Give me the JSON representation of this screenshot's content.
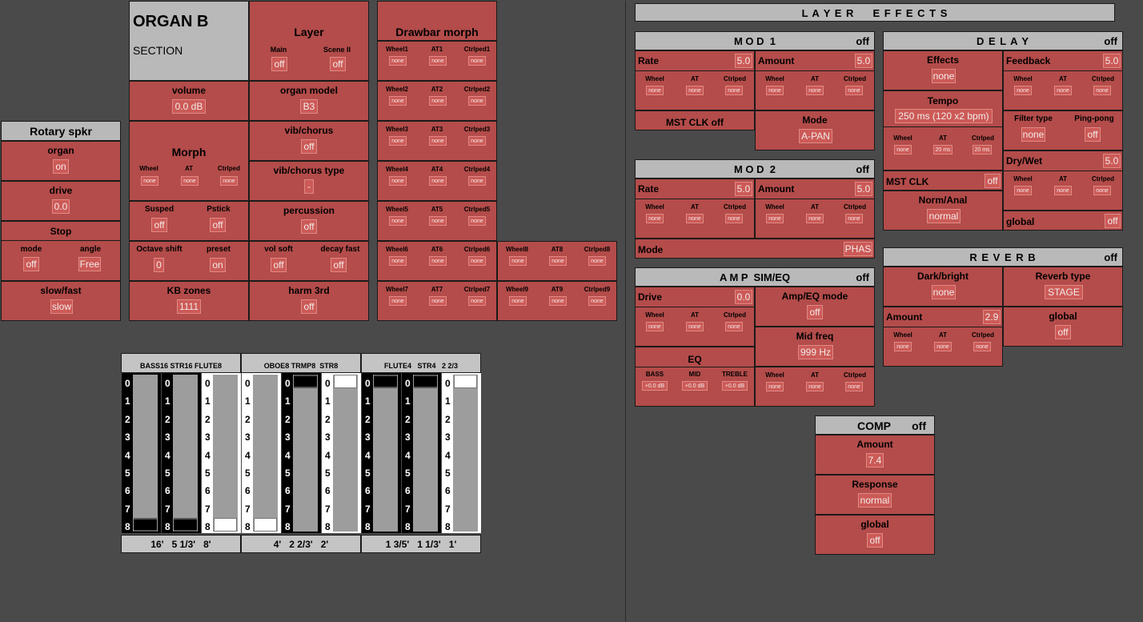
{
  "title": {
    "name": "ORGAN B",
    "sub": "SECTION"
  },
  "layer": {
    "title": "Layer",
    "main_label": "Main",
    "main_value": "off",
    "scene_label": "Scene II",
    "scene_value": "off"
  },
  "volume": {
    "label": "volume",
    "value": "0.0 dB"
  },
  "organ_model": {
    "label": "organ model",
    "value": "B3"
  },
  "vib_chorus": {
    "label": "vib/chorus",
    "value": "off"
  },
  "morph": {
    "title": "Morph",
    "wheel_label": "Wheel",
    "wheel": "none",
    "at_label": "AT",
    "at": "none",
    "ctrl_label": "Ctrlped",
    "ctrl": "none"
  },
  "vib_chorus_type": {
    "label": "vib/chorus type",
    "value": "-"
  },
  "susped": {
    "label": "Susped",
    "value": "off"
  },
  "pstick": {
    "label": "Pstick",
    "value": "off"
  },
  "percussion": {
    "label": "percussion",
    "value": "off"
  },
  "octave_shift": {
    "label": "Octave shift",
    "value": "0"
  },
  "preset": {
    "label": "preset",
    "value": "on"
  },
  "vol_soft": {
    "label": "vol soft",
    "value": "off"
  },
  "decay_fast": {
    "label": "decay fast",
    "value": "off"
  },
  "kb_zones": {
    "label": "KB zones",
    "value": "1111"
  },
  "harm3": {
    "label": "harm 3rd",
    "value": "off"
  },
  "drawbar_morph": {
    "title": "Drawbar morph",
    "rows": [
      {
        "w": "Wheel1",
        "a": "AT1",
        "c": "Ctrlped1",
        "wv": "none",
        "av": "none",
        "cv": "none"
      },
      {
        "w": "Wheel2",
        "a": "AT2",
        "c": "Ctrlped2",
        "wv": "none",
        "av": "none",
        "cv": "none"
      },
      {
        "w": "Wheel3",
        "a": "AT3",
        "c": "Ctrlped3",
        "wv": "none",
        "av": "none",
        "cv": "none"
      },
      {
        "w": "Wheel4",
        "a": "AT4",
        "c": "Ctrlped4",
        "wv": "none",
        "av": "none",
        "cv": "none"
      },
      {
        "w": "Wheel5",
        "a": "AT5",
        "c": "Ctrlped5",
        "wv": "none",
        "av": "none",
        "cv": "none"
      },
      {
        "w": "Wheel6",
        "a": "AT6",
        "c": "Ctrlped6",
        "wv": "none",
        "av": "none",
        "cv": "none"
      },
      {
        "w": "Wheel7",
        "a": "AT7",
        "c": "Ctrlped7",
        "wv": "none",
        "av": "none",
        "cv": "none"
      },
      {
        "w": "Wheel8",
        "a": "AT8",
        "c": "Ctrlped8",
        "wv": "none",
        "av": "none",
        "cv": "none"
      },
      {
        "w": "Wheel9",
        "a": "AT9",
        "c": "Ctrlped9",
        "wv": "none",
        "av": "none",
        "cv": "none"
      }
    ]
  },
  "rotary": {
    "title": "Rotary spkr",
    "organ_label": "organ",
    "organ_value": "on",
    "drive_label": "drive",
    "drive_value": "0.0",
    "stop_label": "Stop",
    "mode_label": "mode",
    "mode_value": "off",
    "angle_label": "angle",
    "angle_value": "Free",
    "slowfast_label": "slow/fast",
    "slowfast_value": "slow"
  },
  "drawbars": {
    "groups": [
      {
        "header": "BASS16 STR16 FLUTE8",
        "footer": "16'   5 1/3'   8'"
      },
      {
        "header": "OBOE8 TRMP8  STR8",
        "footer": "4'   2 2/3'   2'"
      },
      {
        "header": "FLUTE4   STR4   2 2/3",
        "footer": "1 3/5'   1 1/3'   1'"
      }
    ],
    "numbers": [
      "0",
      "1",
      "2",
      "3",
      "4",
      "5",
      "6",
      "7",
      "8"
    ],
    "values": [
      8,
      8,
      8,
      8,
      0,
      0,
      0,
      0,
      0
    ],
    "colors": [
      "black",
      "black",
      "white",
      "white",
      "black",
      "white",
      "black",
      "black",
      "white"
    ]
  },
  "layer_effects": {
    "title": "L A Y E R     E F F E C T S"
  },
  "mod1": {
    "title": "M O D  1",
    "status": "off",
    "rate_label": "Rate",
    "rate_value": "5.0",
    "amount_label": "Amount",
    "amount_value": "5.0",
    "mst_clk": "MST CLK off",
    "mode_label": "Mode",
    "mode_value": "A-PAN",
    "wheel_label": "Wheel",
    "at_label": "AT",
    "ctrl_label": "Ctrlped",
    "none": "none"
  },
  "mod2": {
    "title": "M O D  2",
    "status": "off",
    "rate_label": "Rate",
    "rate_value": "5.0",
    "amount_label": "Amount",
    "amount_value": "5.0",
    "mode_label": "Mode",
    "mode_value": "PHAS"
  },
  "amp": {
    "title": "A M P  SIM/EQ",
    "status": "off",
    "drive_label": "Drive",
    "drive_value": "0.0",
    "ampeq_label": "Amp/EQ mode",
    "ampeq_value": "off",
    "eq_label": "EQ",
    "midfreq_label": "Mid freq",
    "midfreq_value": "999 Hz",
    "bass_label": "BASS",
    "bass_value": "+0.0 dB",
    "mid_label": "MID",
    "mid_value": "+0.0 dB",
    "treble_label": "TREBLE",
    "treble_value": "+0.0 dB"
  },
  "delay": {
    "title": "D E L A Y",
    "status": "off",
    "effects_label": "Effects",
    "effects_value": "none",
    "feedback_label": "Feedback",
    "feedback_value": "5.0",
    "tempo_label": "Tempo",
    "tempo_value": "250 ms (120 x2 bpm)",
    "filter_label": "Filter type",
    "filter_value": "none",
    "pingpong_label": "Ping-pong",
    "pingpong_value": "off",
    "at_value": "20 ms",
    "ctrl_value": "20 ms",
    "drywet_label": "Dry/Wet",
    "drywet_value": "5.0",
    "mstclk_label": "MST CLK",
    "mstclk_value": "off",
    "norm_label": "Norm/Anal",
    "norm_value": "normal",
    "global_label": "global",
    "global_value": "off"
  },
  "reverb": {
    "title": "R E V E R B",
    "status": "off",
    "dark_label": "Dark/bright",
    "dark_value": "none",
    "type_label": "Reverb type",
    "type_value": "STAGE",
    "amount_label": "Amount",
    "amount_value": "2.9",
    "global_label": "global",
    "global_value": "off"
  },
  "comp": {
    "title": "COMP",
    "status": "off",
    "amount_label": "Amount",
    "amount_value": "7.4",
    "response_label": "Response",
    "response_value": "normal",
    "global_label": "global",
    "global_value": "off"
  }
}
